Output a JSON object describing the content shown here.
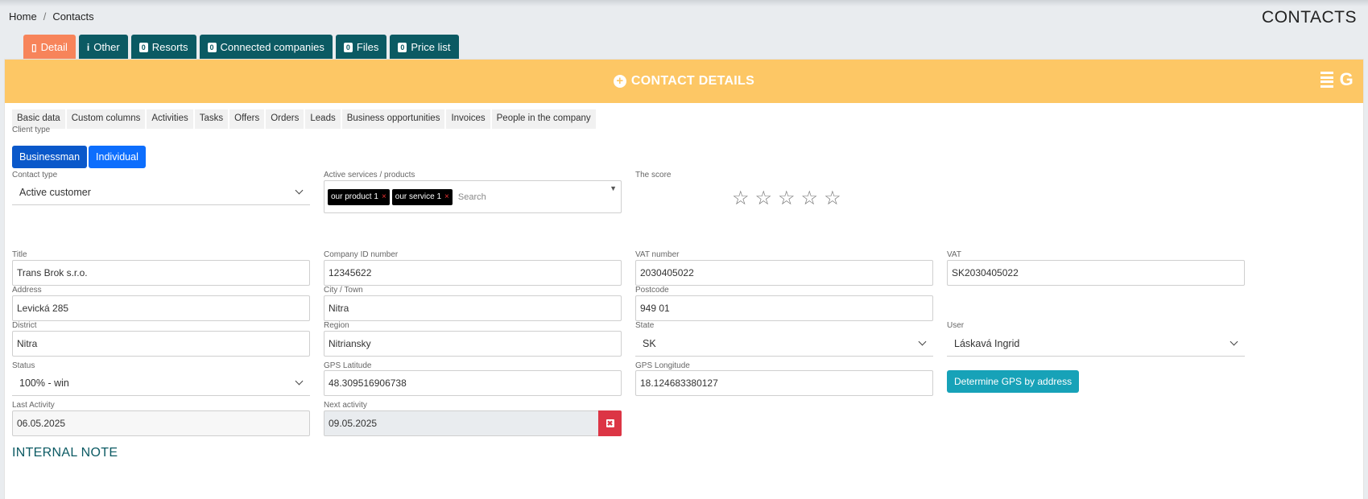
{
  "breadcrumb": {
    "home": "Home",
    "sep": "/",
    "current": "Contacts"
  },
  "page_title": "CONTACTS",
  "tabs": [
    {
      "label": "Detail",
      "icon": "building-icon",
      "glyph": "▯"
    },
    {
      "label": "Other",
      "icon": "info-icon",
      "glyph": "i"
    },
    {
      "label": "Resorts",
      "badge": "0"
    },
    {
      "label": "Connected companies",
      "badge": "0"
    },
    {
      "label": "Files",
      "badge": "0"
    },
    {
      "label": "Price list",
      "badge": "0"
    }
  ],
  "panel": {
    "title": "CONTACT DETAILS",
    "plus": "+",
    "tool_icon_g": "G"
  },
  "subtabs": [
    "Basic data",
    "Custom columns",
    "Activities",
    "Tasks",
    "Offers",
    "Orders",
    "Leads",
    "Business opportunities",
    "Invoices",
    "People in the company"
  ],
  "client_type": {
    "label": "Client type",
    "options": [
      "Businessman",
      "Individual"
    ]
  },
  "contact_type": {
    "label": "Contact type",
    "value": "Active customer"
  },
  "services": {
    "label": "Active services / products",
    "tags": [
      "our product 1",
      "our service 1"
    ],
    "remove": "×",
    "placeholder": "Search",
    "arrow": "▼"
  },
  "score": {
    "label": "The score",
    "value": 0,
    "max": 5,
    "star": "☆"
  },
  "fields": {
    "title": {
      "label": "Title",
      "value": "Trans Brok s.r.o."
    },
    "company_id": {
      "label": "Company ID number",
      "value": "12345622"
    },
    "vat_number": {
      "label": "VAT number",
      "value": "2030405022"
    },
    "vat": {
      "label": "VAT",
      "value": "SK2030405022"
    },
    "address": {
      "label": "Address",
      "value": "Levická 285"
    },
    "city": {
      "label": "City / Town",
      "value": "Nitra"
    },
    "postcode": {
      "label": "Postcode",
      "value": "949 01"
    },
    "district": {
      "label": "District",
      "value": "Nitra"
    },
    "region": {
      "label": "Region",
      "value": "Nitriansky"
    },
    "state": {
      "label": "State",
      "value": "SK"
    },
    "user": {
      "label": "User",
      "value": "Láskavá Ingrid"
    },
    "status": {
      "label": "Status",
      "value": "100% - win"
    },
    "gps_lat": {
      "label": "GPS Latitude",
      "value": "48.309516906738"
    },
    "gps_lon": {
      "label": "GPS Longitude",
      "value": "18.124683380127"
    },
    "last_activity": {
      "label": "Last Activity",
      "value": "06.05.2025"
    },
    "next_activity": {
      "label": "Next activity",
      "value": "09.05.2025"
    }
  },
  "gps_button": "Determine GPS by address",
  "clear_icon": "✖",
  "internal_note_title": "INTERNAL NOTE",
  "colors": {
    "header": "#fdc765",
    "tab": "#0b5a63",
    "active_tab": "#f7845a",
    "primary": "#0d6efd",
    "teal": "#17a2b8",
    "danger": "#dc3545"
  }
}
